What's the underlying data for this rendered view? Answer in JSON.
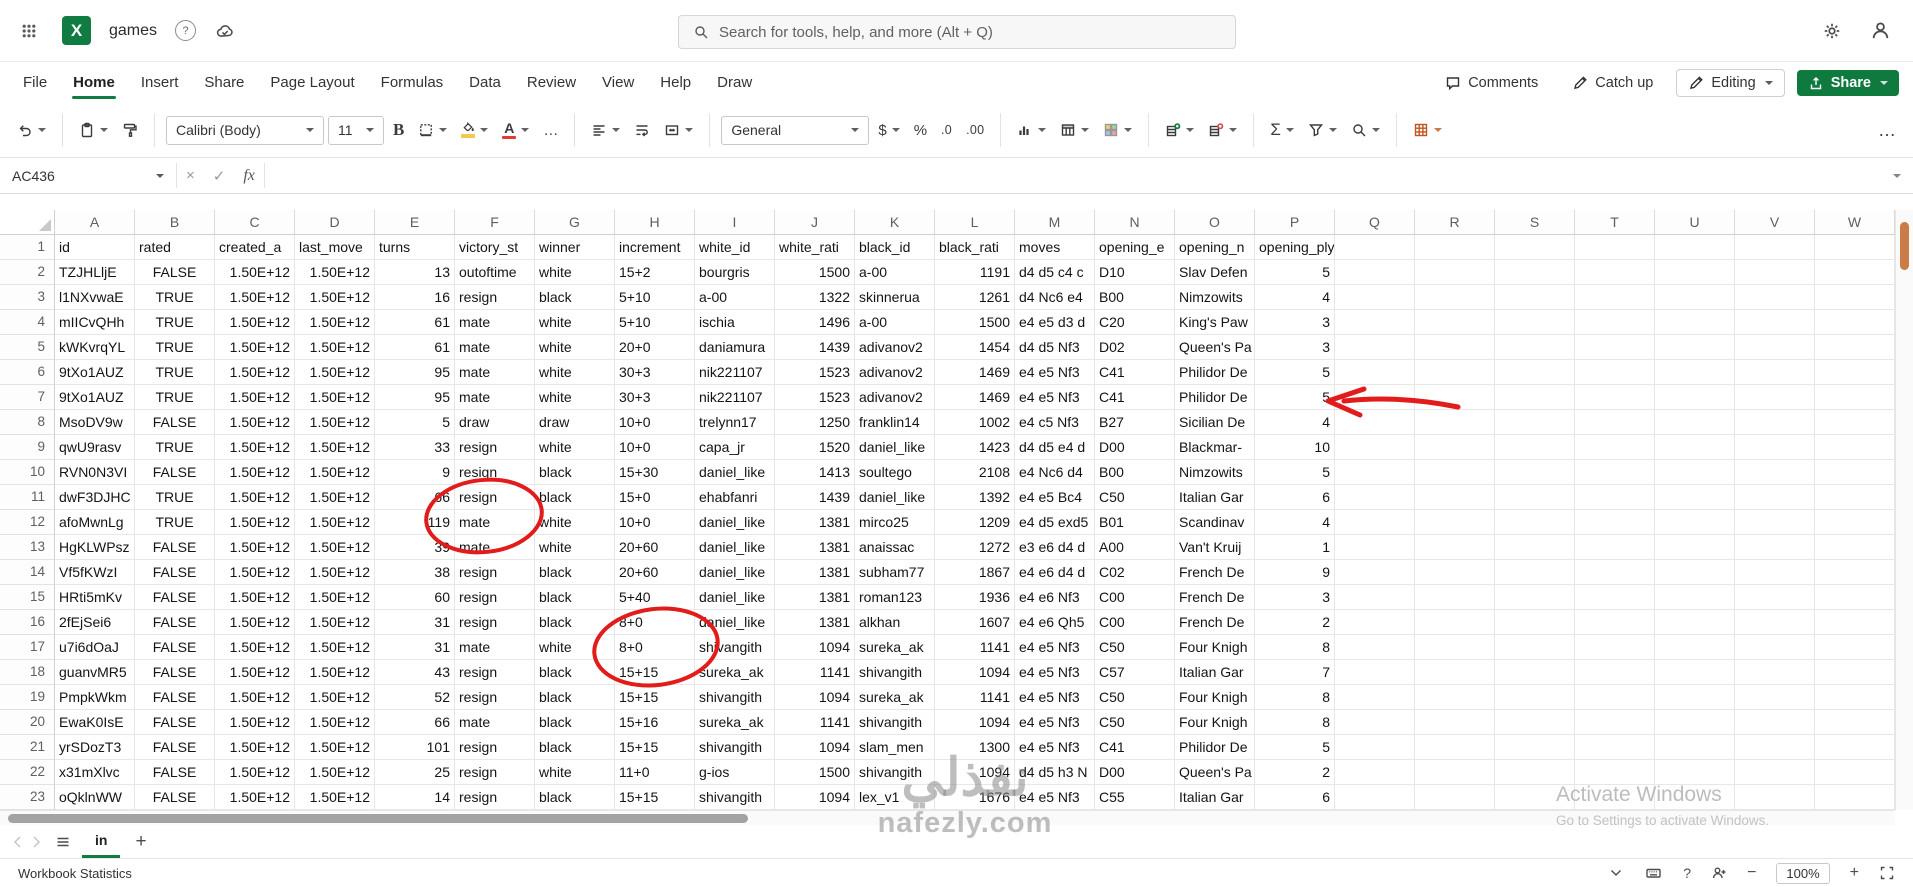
{
  "colors": {
    "excel_green": "#107C41",
    "share_green": "#0E7A3E",
    "annotation_red": "#E21B1B",
    "font_color_red": "#E03C31",
    "fill_yellow": "#F2C94C",
    "scroll_thumb_orange": "#C97C45"
  },
  "topbar": {
    "title": "games",
    "excel_logo_letter": "X",
    "badge": "?",
    "search_placeholder": "Search for tools, help, and more (Alt + Q)"
  },
  "menubar": {
    "items": [
      "File",
      "Home",
      "Insert",
      "Share",
      "Page Layout",
      "Formulas",
      "Data",
      "Review",
      "View",
      "Help",
      "Draw"
    ],
    "active": "Home",
    "comments": "Comments",
    "catch_up": "Catch up",
    "editing": "Editing",
    "share": "Share"
  },
  "ribbon": {
    "font_name": "Calibri (Body)",
    "font_size": "11",
    "bold": "B",
    "font_color_letter": "A",
    "number_format": "General",
    "currency": "$",
    "percent": "%",
    "decrease_decimal": ".0",
    "increase_decimal": ".00",
    "autosum": "Σ",
    "more": "…"
  },
  "formula_bar": {
    "name_box": "AC436",
    "cancel": "×",
    "enter": "✓",
    "fx": "fx"
  },
  "sheet": {
    "columns": [
      "A",
      "B",
      "C",
      "D",
      "E",
      "F",
      "G",
      "H",
      "I",
      "J",
      "K",
      "L",
      "M",
      "N",
      "O",
      "P",
      "Q",
      "R",
      "S",
      "T",
      "U",
      "V",
      "W"
    ],
    "column_align": [
      "l",
      "c",
      "r",
      "r",
      "r",
      "l",
      "l",
      "l",
      "l",
      "r",
      "l",
      "r",
      "l",
      "l",
      "l",
      "r"
    ],
    "rows": [
      [
        "id",
        "rated",
        "created_a",
        "last_move",
        "turns",
        "victory_st",
        "winner",
        "increment",
        "white_id",
        "white_rati",
        "black_id",
        "black_rati",
        "moves",
        "opening_e",
        "opening_n",
        "opening_ply"
      ],
      [
        "TZJHLljE",
        "FALSE",
        "1.50E+12",
        "1.50E+12",
        "13",
        "outoftime",
        "white",
        "15+2",
        "bourgris",
        "1500",
        "a-00",
        "1191",
        "d4 d5 c4 c",
        "D10",
        "Slav Defen",
        "5"
      ],
      [
        "l1NXvwaE",
        "TRUE",
        "1.50E+12",
        "1.50E+12",
        "16",
        "resign",
        "black",
        "5+10",
        "a-00",
        "1322",
        "skinnerua",
        "1261",
        "d4 Nc6 e4",
        "B00",
        "Nimzowits",
        "4"
      ],
      [
        "mIICvQHh",
        "TRUE",
        "1.50E+12",
        "1.50E+12",
        "61",
        "mate",
        "white",
        "5+10",
        "ischia",
        "1496",
        "a-00",
        "1500",
        "e4 e5 d3 d",
        "C20",
        "King's Paw",
        "3"
      ],
      [
        "kWKvrqYL",
        "TRUE",
        "1.50E+12",
        "1.50E+12",
        "61",
        "mate",
        "white",
        "20+0",
        "daniamura",
        "1439",
        "adivanov2",
        "1454",
        "d4 d5 Nf3",
        "D02",
        "Queen's Pa",
        "3"
      ],
      [
        "9tXo1AUZ",
        "TRUE",
        "1.50E+12",
        "1.50E+12",
        "95",
        "mate",
        "white",
        "30+3",
        "nik221107",
        "1523",
        "adivanov2",
        "1469",
        "e4 e5 Nf3",
        "C41",
        "Philidor De",
        "5"
      ],
      [
        "9tXo1AUZ",
        "TRUE",
        "1.50E+12",
        "1.50E+12",
        "95",
        "mate",
        "white",
        "30+3",
        "nik221107",
        "1523",
        "adivanov2",
        "1469",
        "e4 e5 Nf3",
        "C41",
        "Philidor De",
        "5"
      ],
      [
        "MsoDV9w",
        "FALSE",
        "1.50E+12",
        "1.50E+12",
        "5",
        "draw",
        "draw",
        "10+0",
        "trelynn17",
        "1250",
        "franklin14",
        "1002",
        "e4 c5 Nf3",
        "B27",
        "Sicilian De",
        "4"
      ],
      [
        "qwU9rasv",
        "TRUE",
        "1.50E+12",
        "1.50E+12",
        "33",
        "resign",
        "white",
        "10+0",
        "capa_jr",
        "1520",
        "daniel_like",
        "1423",
        "d4 d5 e4 d",
        "D00",
        "Blackmar-",
        "10"
      ],
      [
        "RVN0N3VI",
        "FALSE",
        "1.50E+12",
        "1.50E+12",
        "9",
        "resign",
        "black",
        "15+30",
        "daniel_like",
        "1413",
        "soultego",
        "2108",
        "e4 Nc6 d4",
        "B00",
        "Nimzowits",
        "5"
      ],
      [
        "dwF3DJHC",
        "TRUE",
        "1.50E+12",
        "1.50E+12",
        "66",
        "resign",
        "black",
        "15+0",
        "ehabfanri",
        "1439",
        "daniel_like",
        "1392",
        "e4 e5 Bc4",
        "C50",
        "Italian Gar",
        "6"
      ],
      [
        "afoMwnLg",
        "TRUE",
        "1.50E+12",
        "1.50E+12",
        "119",
        "mate",
        "white",
        "10+0",
        "daniel_like",
        "1381",
        "mirco25",
        "1209",
        "e4 d5 exd5",
        "B01",
        "Scandinav",
        "4"
      ],
      [
        "HgKLWPsz",
        "FALSE",
        "1.50E+12",
        "1.50E+12",
        "39",
        "mate",
        "white",
        "20+60",
        "daniel_like",
        "1381",
        "anaissac",
        "1272",
        "e3 e6 d4 d",
        "A00",
        "Van't Kruij",
        "1"
      ],
      [
        "Vf5fKWzI",
        "FALSE",
        "1.50E+12",
        "1.50E+12",
        "38",
        "resign",
        "black",
        "20+60",
        "daniel_like",
        "1381",
        "subham77",
        "1867",
        "e4 e6 d4 d",
        "C02",
        "French De",
        "9"
      ],
      [
        "HRti5mKv",
        "FALSE",
        "1.50E+12",
        "1.50E+12",
        "60",
        "resign",
        "black",
        "5+40",
        "daniel_like",
        "1381",
        "roman123",
        "1936",
        "e4 e6 Nf3",
        "C00",
        "French De",
        "3"
      ],
      [
        "2fEjSei6",
        "FALSE",
        "1.50E+12",
        "1.50E+12",
        "31",
        "resign",
        "black",
        "8+0",
        "daniel_like",
        "1381",
        "alkhan",
        "1607",
        "e4 e6 Qh5",
        "C00",
        "French De",
        "2"
      ],
      [
        "u7i6dOaJ",
        "FALSE",
        "1.50E+12",
        "1.50E+12",
        "31",
        "mate",
        "white",
        "8+0",
        "shivangith",
        "1094",
        "sureka_ak",
        "1141",
        "e4 e5 Nf3",
        "C50",
        "Four Knigh",
        "8"
      ],
      [
        "guanvMR5",
        "FALSE",
        "1.50E+12",
        "1.50E+12",
        "43",
        "resign",
        "black",
        "15+15",
        "sureka_ak",
        "1141",
        "shivangith",
        "1094",
        "e4 e5 Nf3",
        "C57",
        "Italian Gar",
        "7"
      ],
      [
        "PmpkWkm",
        "FALSE",
        "1.50E+12",
        "1.50E+12",
        "52",
        "resign",
        "black",
        "15+15",
        "shivangith",
        "1094",
        "sureka_ak",
        "1141",
        "e4 e5 Nf3",
        "C50",
        "Four Knigh",
        "8"
      ],
      [
        "EwaK0IsE",
        "FALSE",
        "1.50E+12",
        "1.50E+12",
        "66",
        "mate",
        "black",
        "15+16",
        "sureka_ak",
        "1141",
        "shivangith",
        "1094",
        "e4 e5 Nf3",
        "C50",
        "Four Knigh",
        "8"
      ],
      [
        "yrSDozT3",
        "FALSE",
        "1.50E+12",
        "1.50E+12",
        "101",
        "resign",
        "black",
        "15+15",
        "shivangith",
        "1094",
        "slam_men",
        "1300",
        "e4 e5 Nf3",
        "C41",
        "Philidor De",
        "5"
      ],
      [
        "x31mXlvc",
        "FALSE",
        "1.50E+12",
        "1.50E+12",
        "25",
        "resign",
        "white",
        "11+0",
        "g-ios",
        "1500",
        "shivangith",
        "1094",
        "d4 d5 h3 N",
        "D00",
        "Queen's Pa",
        "2"
      ],
      [
        "oQklnWW",
        "FALSE",
        "1.50E+12",
        "1.50E+12",
        "14",
        "resign",
        "black",
        "15+15",
        "shivangith",
        "1094",
        "lex_v1",
        "1676",
        "e4 e5 Nf3",
        "C55",
        "Italian Gar",
        "6"
      ]
    ]
  },
  "ink_annotations": [
    {
      "type": "ellipse",
      "target": "F11:F12"
    },
    {
      "type": "ellipse",
      "target": "H16:H17"
    },
    {
      "type": "arrow-left",
      "target": "P7"
    }
  ],
  "sheetbar": {
    "tabs": [
      "in"
    ],
    "add": "+"
  },
  "statusbar": {
    "left": "Workbook Statistics",
    "help": "?",
    "zoom_out": "−",
    "zoom": "100%",
    "zoom_in": "+"
  },
  "watermarks": {
    "activate_line1": "Activate Windows",
    "activate_line2": "Go to Settings to activate Windows.",
    "brand_ar": "نفذلي",
    "brand_domain": "nafezly.com"
  }
}
